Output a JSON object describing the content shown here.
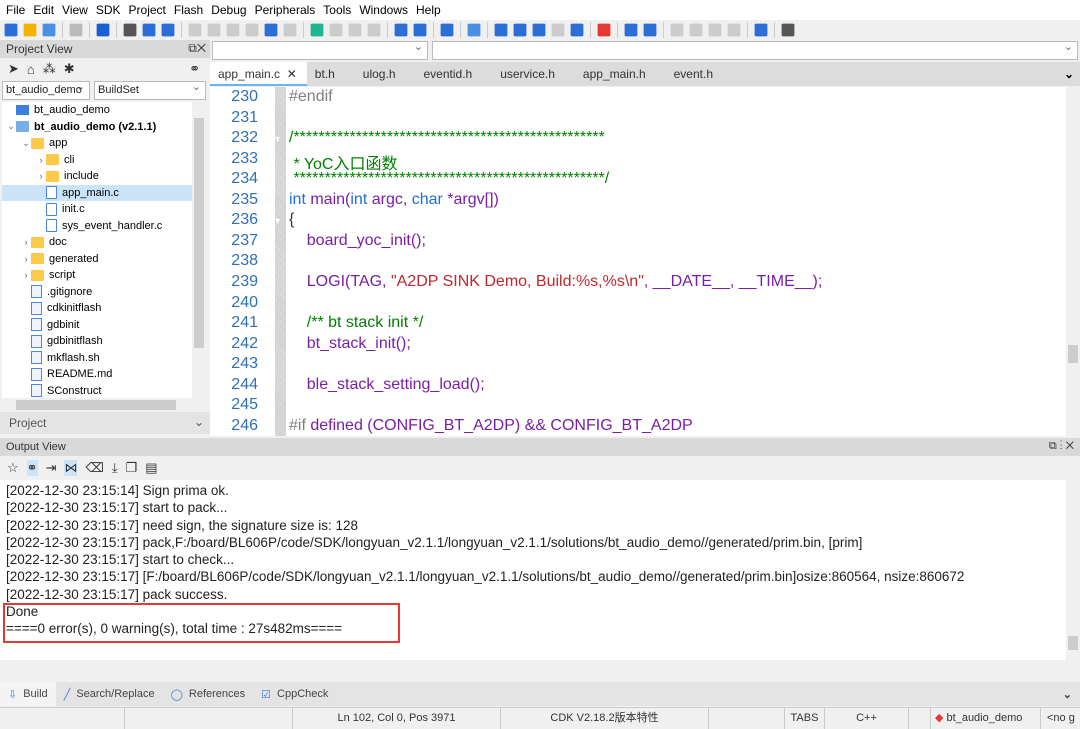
{
  "menu": [
    "File",
    "Edit",
    "View",
    "SDK",
    "Project",
    "Flash",
    "Debug",
    "Peripherals",
    "Tools",
    "Windows",
    "Help"
  ],
  "project_view": {
    "title": "Project View",
    "project_combo": "bt_audio_demo",
    "buildset_combo": "BuildSet",
    "tree": [
      {
        "label": "bt_audio_demo",
        "icon": "monitor",
        "depth": 0,
        "arrow": ""
      },
      {
        "label": "bt_audio_demo (v2.1.1)",
        "icon": "project",
        "depth": 0,
        "arrow": "⌄",
        "bold": true
      },
      {
        "label": "app",
        "icon": "folder",
        "depth": 1,
        "arrow": "⌄"
      },
      {
        "label": "cli",
        "icon": "folder",
        "depth": 2,
        "arrow": "›"
      },
      {
        "label": "include",
        "icon": "folder",
        "depth": 2,
        "arrow": "›"
      },
      {
        "label": "app_main.c",
        "icon": "c-file",
        "depth": 2,
        "arrow": "",
        "selected": true
      },
      {
        "label": "init.c",
        "icon": "c-file",
        "depth": 2,
        "arrow": ""
      },
      {
        "label": "sys_event_handler.c",
        "icon": "c-file",
        "depth": 2,
        "arrow": ""
      },
      {
        "label": "doc",
        "icon": "folder",
        "depth": 1,
        "arrow": "›"
      },
      {
        "label": "generated",
        "icon": "folder",
        "depth": 1,
        "arrow": "›"
      },
      {
        "label": "script",
        "icon": "folder",
        "depth": 1,
        "arrow": "›"
      },
      {
        "label": ".gitignore",
        "icon": "file",
        "depth": 1,
        "arrow": ""
      },
      {
        "label": "cdkinitflash",
        "icon": "file",
        "depth": 1,
        "arrow": ""
      },
      {
        "label": "gdbinit",
        "icon": "file",
        "depth": 1,
        "arrow": ""
      },
      {
        "label": "gdbinitflash",
        "icon": "file",
        "depth": 1,
        "arrow": ""
      },
      {
        "label": "mkflash.sh",
        "icon": "file",
        "depth": 1,
        "arrow": ""
      },
      {
        "label": "README.md",
        "icon": "file",
        "depth": 1,
        "arrow": ""
      },
      {
        "label": "SConstruct",
        "icon": "file",
        "depth": 1,
        "arrow": ""
      }
    ],
    "bottom_tab": "Project"
  },
  "editor": {
    "tabs": [
      {
        "label": "app_main.c",
        "active": true
      },
      {
        "label": "bt.h"
      },
      {
        "label": "ulog.h"
      },
      {
        "label": "eventid.h"
      },
      {
        "label": "uservice.h"
      },
      {
        "label": "app_main.h"
      },
      {
        "label": "event.h"
      }
    ],
    "lines": [
      {
        "n": "230",
        "tokens": [
          [
            "#endif",
            "pp"
          ]
        ]
      },
      {
        "n": "231",
        "tokens": []
      },
      {
        "n": "232",
        "tokens": [
          [
            "/**************************************************",
            "cm"
          ]
        ],
        "fold": true
      },
      {
        "n": "233",
        "tokens": [
          [
            " * YoC入口函数",
            "cm"
          ]
        ]
      },
      {
        "n": "234",
        "tokens": [
          [
            " **************************************************/",
            "cm"
          ]
        ]
      },
      {
        "n": "235",
        "tokens": [
          [
            "int",
            "kw"
          ],
          [
            " main(",
            "id"
          ],
          [
            "int",
            "kw"
          ],
          [
            " argc, ",
            "id"
          ],
          [
            "char",
            "kw"
          ],
          [
            " *argv[])",
            "id"
          ]
        ]
      },
      {
        "n": "236",
        "tokens": [
          [
            "{",
            "pl"
          ]
        ],
        "fold": true
      },
      {
        "n": "237",
        "tokens": [
          [
            "    board_yoc_init();",
            "id"
          ]
        ]
      },
      {
        "n": "238",
        "tokens": []
      },
      {
        "n": "239",
        "tokens": [
          [
            "    LOGI(TAG, ",
            "id"
          ],
          [
            "\"A2DP SINK Demo, Build:%s,%s\\n\"",
            "st"
          ],
          [
            ", __DATE__, __TIME__);",
            "id"
          ]
        ]
      },
      {
        "n": "240",
        "tokens": []
      },
      {
        "n": "241",
        "tokens": [
          [
            "    /** bt stack init */",
            "cm"
          ]
        ]
      },
      {
        "n": "242",
        "tokens": [
          [
            "    bt_stack_init();",
            "id"
          ]
        ]
      },
      {
        "n": "243",
        "tokens": []
      },
      {
        "n": "244",
        "tokens": [
          [
            "    ble_stack_setting_load();",
            "id"
          ]
        ]
      },
      {
        "n": "245",
        "tokens": []
      },
      {
        "n": "246",
        "tokens": [
          [
            "#if ",
            "pp"
          ],
          [
            "defined (CONFIG_BT_A2DP) && CONFIG_BT_A2DP",
            "id"
          ]
        ]
      }
    ]
  },
  "output": {
    "title": "Output View",
    "lines": [
      "[2022-12-30 23:15:14] Sign prima ok.",
      "[2022-12-30 23:15:17] start to pack...",
      "[2022-12-30 23:15:17] need sign, the signature size is: 128",
      "[2022-12-30 23:15:17] pack,F:/board/BL606P/code/SDK/longyuan_v2.1.1/longyuan_v2.1.1/solutions/bt_audio_demo//generated/prim.bin, [prim]",
      "[2022-12-30 23:15:17] start to check...",
      "[2022-12-30 23:15:17] [F:/board/BL606P/code/SDK/longyuan_v2.1.1/longyuan_v2.1.1/solutions/bt_audio_demo//generated/prim.bin]osize:860564, nsize:860672",
      "[2022-12-30 23:15:17] pack success.",
      "Done",
      "====0 error(s), 0 warning(s), total time : 27s482ms===="
    ],
    "highlight_color": "#e53935"
  },
  "bottom_tabs": [
    {
      "label": "Build",
      "icon": "build-icon"
    },
    {
      "label": "Search/Replace",
      "icon": "pencil-icon"
    },
    {
      "label": "References",
      "icon": "circle-icon"
    },
    {
      "label": "CppCheck",
      "icon": "checkbox-icon"
    }
  ],
  "status": {
    "position": "Ln 102, Col 0, Pos 3971",
    "version": "CDK V2.18.2版本特性",
    "indent": "TABS",
    "language": "C++",
    "project": "bt_audio_demo",
    "git": "<no g"
  }
}
